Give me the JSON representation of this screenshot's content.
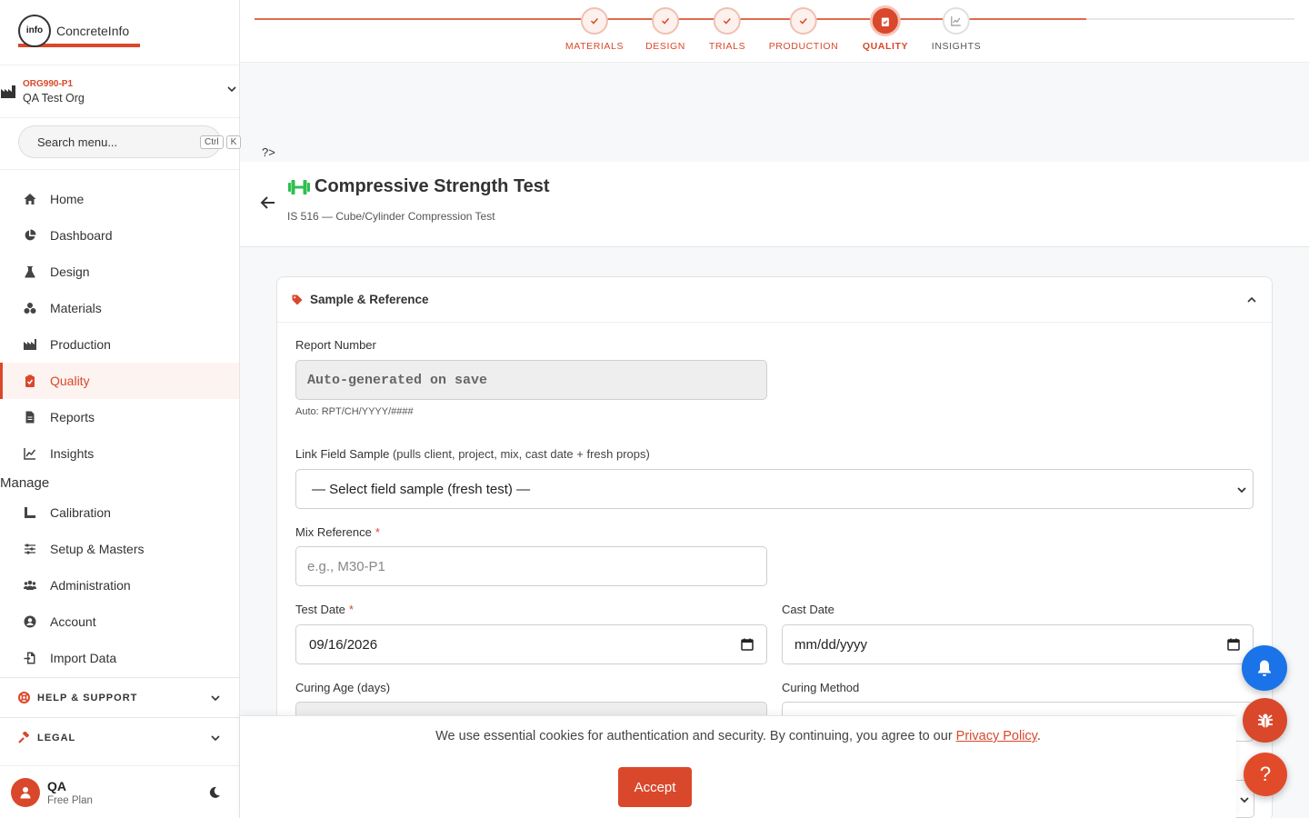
{
  "sidebar": {
    "logo_text": "ConcreteInfo",
    "logo_mark": "info",
    "org_code": "ORG990-P1",
    "org_name": "QA Test Org",
    "search_placeholder": "Search menu...",
    "shortcut": [
      "Ctrl",
      "K"
    ],
    "nav": [
      {
        "label": "Home",
        "icon": "home-icon"
      },
      {
        "label": "Dashboard",
        "icon": "pie-chart-icon"
      },
      {
        "label": "Design",
        "icon": "flask-icon"
      },
      {
        "label": "Materials",
        "icon": "boxes-icon"
      },
      {
        "label": "Production",
        "icon": "factory-icon"
      },
      {
        "label": "Quality",
        "icon": "clipboard-check-icon",
        "active": true
      },
      {
        "label": "Reports",
        "icon": "file-icon"
      },
      {
        "label": "Insights",
        "icon": "line-chart-icon"
      }
    ],
    "manage_label": "Manage",
    "manage": [
      {
        "label": "Calibration",
        "icon": "ruler-icon"
      },
      {
        "label": "Setup & Masters",
        "icon": "sliders-icon"
      },
      {
        "label": "Administration",
        "icon": "users-icon"
      },
      {
        "label": "Account",
        "icon": "user-circle-icon"
      },
      {
        "label": "Import Data",
        "icon": "file-import-icon"
      }
    ],
    "help_label": "HELP & SUPPORT",
    "legal_label": "LEGAL",
    "user_name": "QA",
    "user_plan": "Free Plan"
  },
  "stepper": {
    "steps": [
      {
        "label": "MATERIALS",
        "state": "done"
      },
      {
        "label": "DESIGN",
        "state": "done"
      },
      {
        "label": "TRIALS",
        "state": "done"
      },
      {
        "label": "PRODUCTION",
        "state": "done"
      },
      {
        "label": "QUALITY",
        "state": "current"
      },
      {
        "label": "INSIGHTS",
        "state": "future"
      }
    ]
  },
  "stray_text": "?>",
  "page": {
    "title": "Compressive Strength Test",
    "subtitle": "IS 516 — Cube/Cylinder Compression Test"
  },
  "section": {
    "title": "Sample & Reference",
    "report_number_label": "Report Number",
    "report_number_value": "Auto-generated on save",
    "report_number_hint": "Auto: RPT/CH/YYYY/####",
    "link_sample_label": "Link Field Sample",
    "link_sample_hint": "(pulls client, project, mix, cast date + fresh props)",
    "link_sample_value": "— Select field sample (fresh test) —",
    "mix_ref_label": "Mix Reference",
    "mix_ref_placeholder": "e.g., M30-P1",
    "test_date_label": "Test Date",
    "test_date_value": "09/16/2026",
    "cast_date_label": "Cast Date",
    "cast_date_value": "mm/dd/yyyy",
    "curing_age_label": "Curing Age (days)",
    "curing_method_label": "Curing Method",
    "required_mark": "*"
  },
  "cookie": {
    "text": "We use essential cookies for authentication and security. By continuing, you agree to our ",
    "link": "Privacy Policy",
    "end": ".",
    "accept_label": "Accept"
  },
  "fab_help_label": "?",
  "colors": {
    "accent": "#d9482b",
    "bell": "#1a73e8",
    "title_icon": "#2fbf4f"
  }
}
